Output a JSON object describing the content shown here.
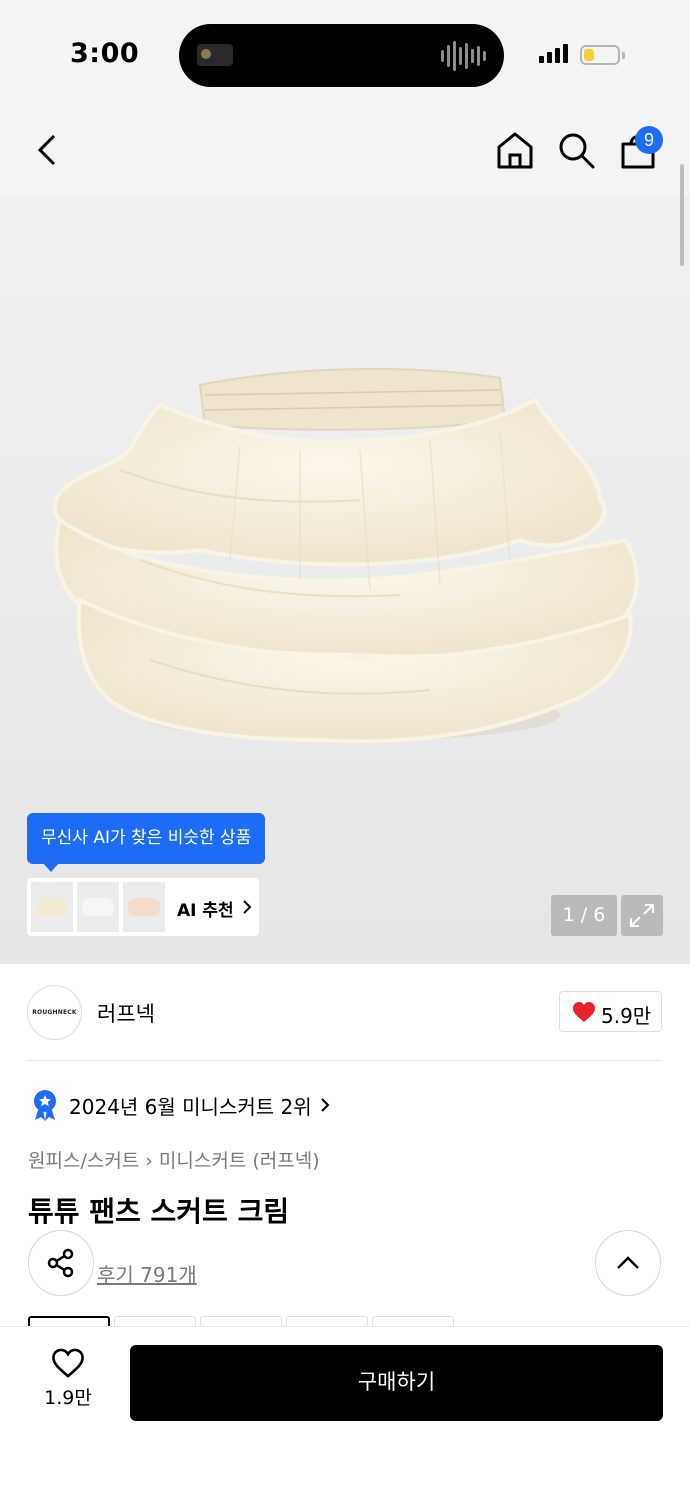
{
  "status_bar": {
    "time": "3:00",
    "battery_level": 0.3
  },
  "nav": {
    "cart_count": "9"
  },
  "ai_recommend": {
    "tooltip": "무신사 AI가 찾은 비슷한 상품",
    "label": "AI 추천"
  },
  "gallery": {
    "counter": "1 / 6"
  },
  "brand": {
    "logo_text": "ROUGHNECK",
    "name": "러프넥",
    "likes": "5.9만"
  },
  "ranking": {
    "text": "2024년 6월 미니스커트 2위"
  },
  "category": {
    "parent": "원피스/스커트",
    "child": "미니스커트 (러프넥)"
  },
  "product": {
    "title": "튜튜 팬츠 스커트 크림",
    "reviews": "후기 791개"
  },
  "bottom": {
    "wish_count": "1.9만",
    "buy_label": "구매하기"
  },
  "colors": {
    "accent": "#1e6bf5",
    "heart": "#e8212b",
    "buy_bg": "#000000",
    "skirt": "#f6eedd"
  }
}
